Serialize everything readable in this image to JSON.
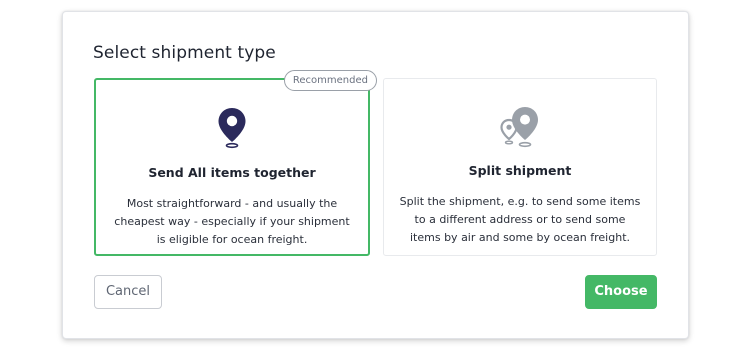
{
  "dialog": {
    "title": "Select shipment type"
  },
  "options": [
    {
      "title": "Send All items together",
      "description": "Most straightforward - and usually the cheapest way - especially if your shipment is eligible for ocean freight.",
      "badge": "Recommended",
      "icon": "location-pin-icon",
      "selected": true
    },
    {
      "title": "Split shipment",
      "description": "Split the shipment, e.g. to send some items to a different address or to send some items by air and some by ocean freight.",
      "icon": "split-location-pins-icon",
      "selected": false
    }
  ],
  "buttons": {
    "cancel_label": "Cancel",
    "choose_label": "Choose"
  },
  "colors": {
    "accent_green": "#44b866",
    "pin_dark": "#2b2a5c",
    "pin_gray": "#9aa0a8",
    "text_dark": "#1f2430"
  }
}
